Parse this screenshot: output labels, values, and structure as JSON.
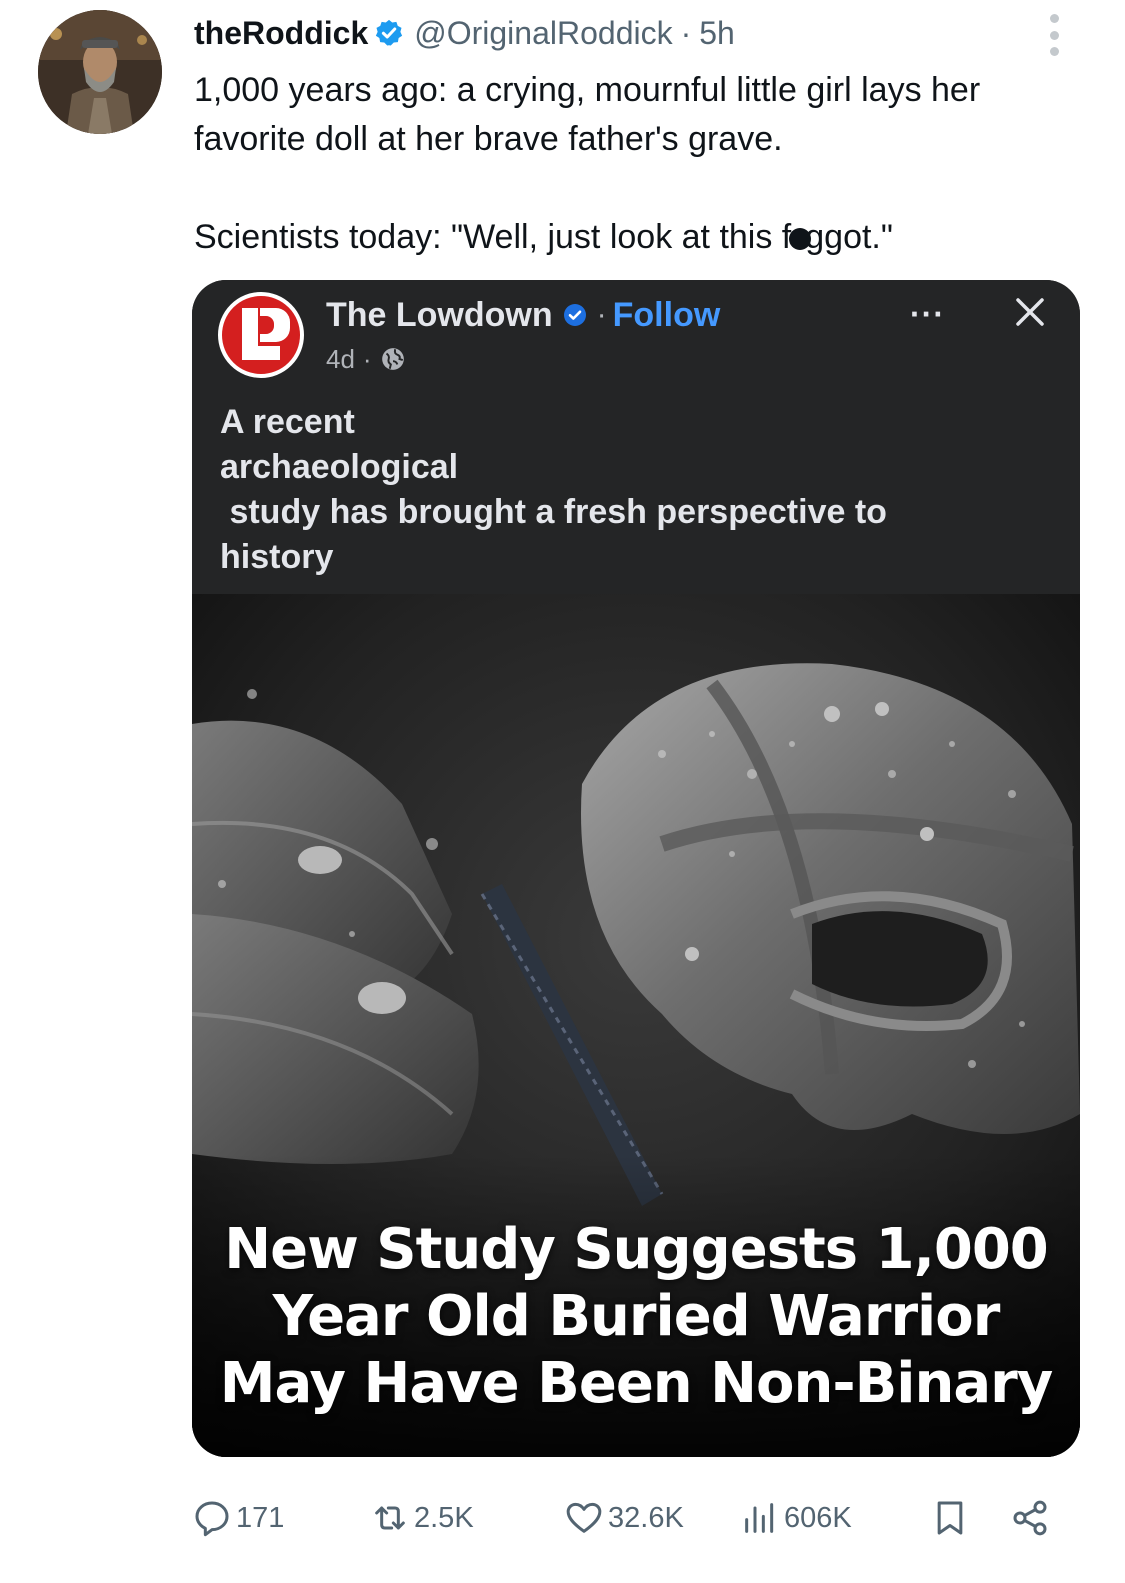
{
  "tweet": {
    "display_name": "theRoddick",
    "handle": "@OriginalRoddick",
    "separator": "·",
    "time": "5h",
    "text_line1": "1,000 years ago: a crying, mournful little girl lays her",
    "text_line2": "favorite doll at her brave father's grave.",
    "text_line3_a": "Scientists today: \"Well, just look at this f",
    "text_line3_b": "ggot.\""
  },
  "quoted_post": {
    "page_name": "The Lowdown",
    "follow_label": "Follow",
    "separator": "·",
    "age": "4d",
    "age_separator": "·",
    "more_label": "···",
    "text_lines": [
      "A recent",
      "archaeological",
      " study has brought a fresh perspective to",
      "history"
    ],
    "headline_lines": [
      "New Study Suggests 1,000",
      "Year Old Buried Warrior",
      "May Have Been Non-Binary"
    ]
  },
  "actions": {
    "replies": "171",
    "reposts": "2.5K",
    "likes": "32.6K",
    "views": "606K"
  },
  "colors": {
    "verified_blue": "#1d9bf0",
    "follow_blue": "#4599ff",
    "logo_red": "#d41f1f",
    "card_bg": "#242526",
    "muted_text": "#536471"
  },
  "icons": [
    "verified-badge-icon",
    "more-vertical-icon",
    "more-horizontal-icon",
    "close-icon",
    "globe-icon",
    "reply-icon",
    "repost-icon",
    "like-icon",
    "views-icon",
    "bookmark-icon",
    "share-icon"
  ]
}
